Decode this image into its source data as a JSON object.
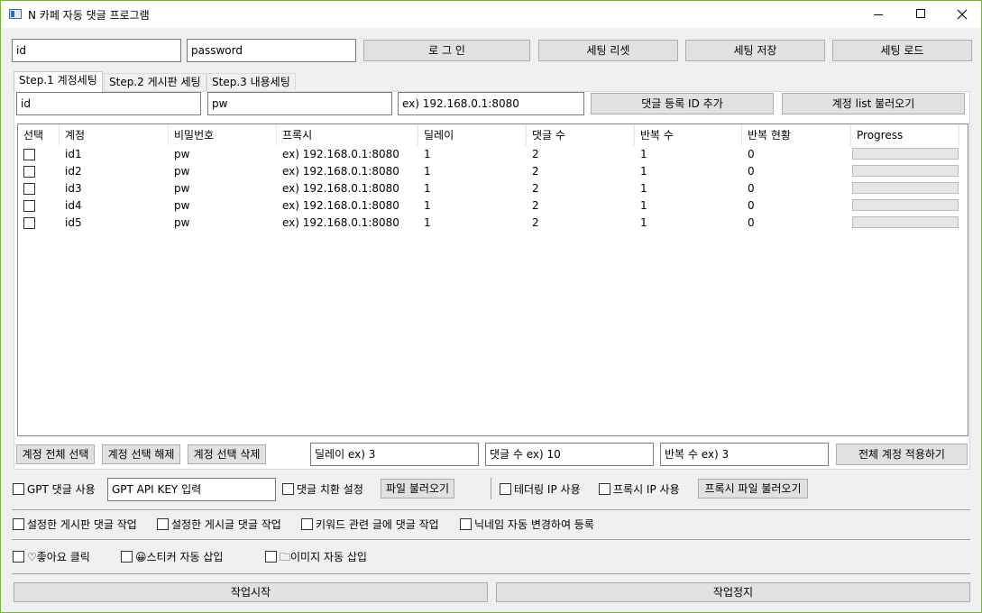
{
  "window": {
    "title": "N 카페 자동 댓글 프로그램"
  },
  "top": {
    "id_value": "id",
    "password_value": "password",
    "login_label": "로 그 인",
    "reset_label": "세팅 리셋",
    "save_label": "세팅 저장",
    "load_label": "세팅 로드"
  },
  "tabs": [
    {
      "label": "Step.1 계정세팅"
    },
    {
      "label": "Step.2 게시판 세팅"
    },
    {
      "label": "Step.3 내용세팅"
    }
  ],
  "account": {
    "id_value": "id",
    "pw_value": "pw",
    "proxy_value": "ex) 192.168.0.1:8080",
    "add_label": "댓글 등록 ID 추가",
    "load_list_label": "계정 list 불러오기"
  },
  "table": {
    "headers": [
      "선택",
      "계정",
      "비밀번호",
      "프록시",
      "딜레이",
      "댓글 수",
      "반복 수",
      "반복 현황",
      "Progress"
    ],
    "rows": [
      {
        "account": "id1",
        "password": "pw",
        "proxy": "ex) 192.168.0.1:8080",
        "delay": "1",
        "comments": "2",
        "repeat": "1",
        "status": "0",
        "progress": 0
      },
      {
        "account": "id2",
        "password": "pw",
        "proxy": "ex) 192.168.0.1:8080",
        "delay": "1",
        "comments": "2",
        "repeat": "1",
        "status": "0",
        "progress": 0
      },
      {
        "account": "id3",
        "password": "pw",
        "proxy": "ex) 192.168.0.1:8080",
        "delay": "1",
        "comments": "2",
        "repeat": "1",
        "status": "0",
        "progress": 0
      },
      {
        "account": "id4",
        "password": "pw",
        "proxy": "ex) 192.168.0.1:8080",
        "delay": "1",
        "comments": "2",
        "repeat": "1",
        "status": "0",
        "progress": 0
      },
      {
        "account": "id5",
        "password": "pw",
        "proxy": "ex) 192.168.0.1:8080",
        "delay": "1",
        "comments": "2",
        "repeat": "1",
        "status": "0",
        "progress": 0
      }
    ]
  },
  "bulk": {
    "select_all_label": "계정 전체 선택",
    "deselect_label": "계정 선택 해제",
    "delete_label": "계정 선택 삭제",
    "delay_value": "딜레이 ex) 3",
    "comments_value": "댓글 수 ex) 10",
    "repeat_value": "반복 수 ex) 3",
    "apply_label": "전체 계정 적용하기"
  },
  "options": {
    "gpt_label": "GPT 댓글 사용",
    "gpt_key_value": "GPT API KEY 입력",
    "replace_label": "댓글 치환 설정",
    "file_load_label": "파일 불러오기",
    "tethering_label": "테더링 IP 사용",
    "proxy_ip_label": "프록시 IP 사용",
    "proxy_file_label": "프록시 파일 불러오기"
  },
  "modes": {
    "board_label": "설정한 게시판 댓글 작업",
    "post_label": "설정한 게시글 댓글 작업",
    "keyword_label": "키워드 관련 글에 댓글 작업",
    "nickname_label": "닉네임 자동 변경하여 등록"
  },
  "extras": {
    "like_label": "♡좋아요 클릭",
    "sticker_label": "😀스티커 자동 삽입",
    "image_label": "🗀이미지 자동 삽입"
  },
  "actions": {
    "start_label": "작업시작",
    "stop_label": "작업정지"
  }
}
